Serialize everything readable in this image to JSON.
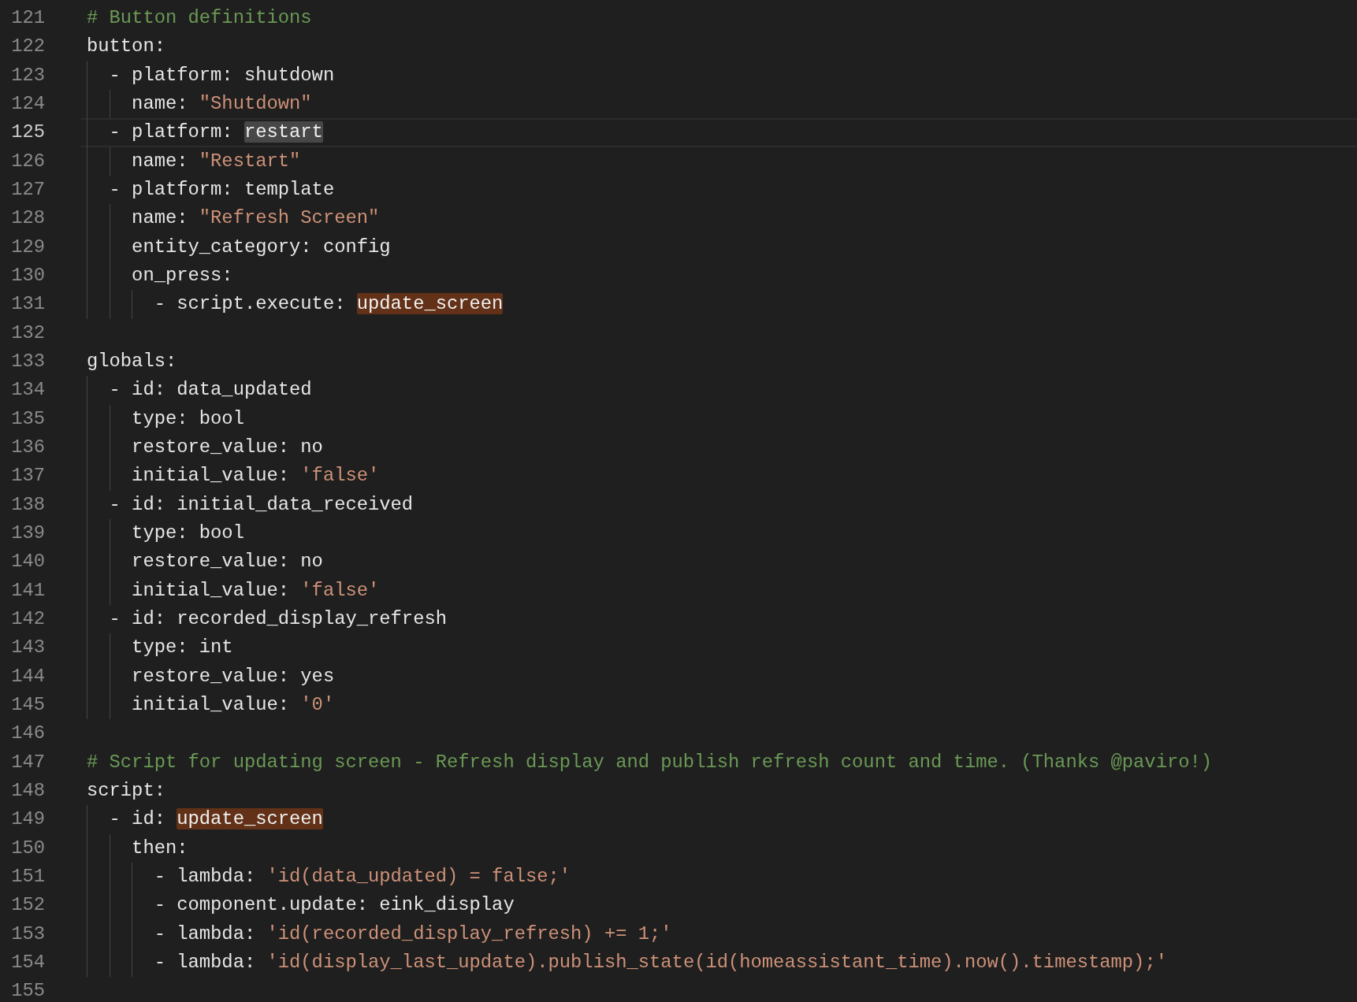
{
  "editor": {
    "lines": [
      {
        "number": "121",
        "current": false,
        "tokens": [
          {
            "text": "# Button definitions",
            "kind": "comment"
          }
        ]
      },
      {
        "number": "122",
        "current": false,
        "tokens": [
          {
            "text": "button:",
            "kind": "plain"
          }
        ]
      },
      {
        "number": "123",
        "current": false,
        "tokens": [
          {
            "text": "  - platform: shutdown",
            "kind": "plain"
          }
        ]
      },
      {
        "number": "124",
        "current": false,
        "tokens": [
          {
            "text": "    name: ",
            "kind": "plain"
          },
          {
            "text": "\"Shutdown\"",
            "kind": "string"
          }
        ]
      },
      {
        "number": "125",
        "current": true,
        "tokens": [
          {
            "text": "  - platform: ",
            "kind": "plain"
          },
          {
            "text": "restart",
            "kind": "selected"
          }
        ]
      },
      {
        "number": "126",
        "current": false,
        "tokens": [
          {
            "text": "    name: ",
            "kind": "plain"
          },
          {
            "text": "\"Restart\"",
            "kind": "string"
          }
        ]
      },
      {
        "number": "127",
        "current": false,
        "tokens": [
          {
            "text": "  - platform: template",
            "kind": "plain"
          }
        ]
      },
      {
        "number": "128",
        "current": false,
        "tokens": [
          {
            "text": "    name: ",
            "kind": "plain"
          },
          {
            "text": "\"Refresh Screen\"",
            "kind": "string"
          }
        ]
      },
      {
        "number": "129",
        "current": false,
        "tokens": [
          {
            "text": "    entity_category: config",
            "kind": "plain"
          }
        ]
      },
      {
        "number": "130",
        "current": false,
        "tokens": [
          {
            "text": "    on_press:",
            "kind": "plain"
          }
        ]
      },
      {
        "number": "131",
        "current": false,
        "tokens": [
          {
            "text": "      - script.execute: ",
            "kind": "plain"
          },
          {
            "text": "update_screen",
            "kind": "match"
          }
        ]
      },
      {
        "number": "132",
        "current": false
      },
      {
        "number": "133",
        "current": false,
        "tokens": [
          {
            "text": "globals:",
            "kind": "plain"
          }
        ]
      },
      {
        "number": "134",
        "current": false,
        "tokens": [
          {
            "text": "  - id: data_updated",
            "kind": "plain"
          }
        ]
      },
      {
        "number": "135",
        "current": false,
        "tokens": [
          {
            "text": "    type: bool",
            "kind": "plain"
          }
        ]
      },
      {
        "number": "136",
        "current": false,
        "tokens": [
          {
            "text": "    restore_value: no",
            "kind": "plain"
          }
        ]
      },
      {
        "number": "137",
        "current": false,
        "tokens": [
          {
            "text": "    initial_value: ",
            "kind": "plain"
          },
          {
            "text": "'false'",
            "kind": "string"
          }
        ]
      },
      {
        "number": "138",
        "current": false,
        "tokens": [
          {
            "text": "  - id: initial_data_received",
            "kind": "plain"
          }
        ]
      },
      {
        "number": "139",
        "current": false,
        "tokens": [
          {
            "text": "    type: bool",
            "kind": "plain"
          }
        ]
      },
      {
        "number": "140",
        "current": false,
        "tokens": [
          {
            "text": "    restore_value: no",
            "kind": "plain"
          }
        ]
      },
      {
        "number": "141",
        "current": false,
        "tokens": [
          {
            "text": "    initial_value: ",
            "kind": "plain"
          },
          {
            "text": "'false'",
            "kind": "string"
          }
        ]
      },
      {
        "number": "142",
        "current": false,
        "tokens": [
          {
            "text": "  - id: recorded_display_refresh",
            "kind": "plain"
          }
        ]
      },
      {
        "number": "143",
        "current": false,
        "tokens": [
          {
            "text": "    type: int",
            "kind": "plain"
          }
        ]
      },
      {
        "number": "144",
        "current": false,
        "tokens": [
          {
            "text": "    restore_value: yes",
            "kind": "plain"
          }
        ]
      },
      {
        "number": "145",
        "current": false,
        "tokens": [
          {
            "text": "    initial_value: ",
            "kind": "plain"
          },
          {
            "text": "'0'",
            "kind": "string"
          }
        ]
      },
      {
        "number": "146",
        "current": false
      },
      {
        "number": "147",
        "current": false,
        "tokens": [
          {
            "text": "# Script for updating screen - Refresh display and publish refresh count and time. (Thanks @paviro!)",
            "kind": "comment"
          }
        ]
      },
      {
        "number": "148",
        "current": false,
        "tokens": [
          {
            "text": "script:",
            "kind": "plain"
          }
        ]
      },
      {
        "number": "149",
        "current": false,
        "tokens": [
          {
            "text": "  - id: ",
            "kind": "plain"
          },
          {
            "text": "update_screen",
            "kind": "match"
          }
        ]
      },
      {
        "number": "150",
        "current": false,
        "tokens": [
          {
            "text": "    then:",
            "kind": "plain"
          }
        ]
      },
      {
        "number": "151",
        "current": false,
        "tokens": [
          {
            "text": "      - lambda: ",
            "kind": "plain"
          },
          {
            "text": "'id(data_updated) = false;'",
            "kind": "string"
          }
        ]
      },
      {
        "number": "152",
        "current": false,
        "tokens": [
          {
            "text": "      - component.update: eink_display",
            "kind": "plain"
          }
        ]
      },
      {
        "number": "153",
        "current": false,
        "tokens": [
          {
            "text": "      - lambda: ",
            "kind": "plain"
          },
          {
            "text": "'id(recorded_display_refresh) += 1;'",
            "kind": "string"
          }
        ]
      },
      {
        "number": "154",
        "current": false,
        "tokens": [
          {
            "text": "      - lambda: ",
            "kind": "plain"
          },
          {
            "text": "'id(display_last_update).publish_state(id(homeassistant_time).now().timestamp);'",
            "kind": "string"
          }
        ]
      },
      {
        "number": "155",
        "current": false
      }
    ]
  }
}
